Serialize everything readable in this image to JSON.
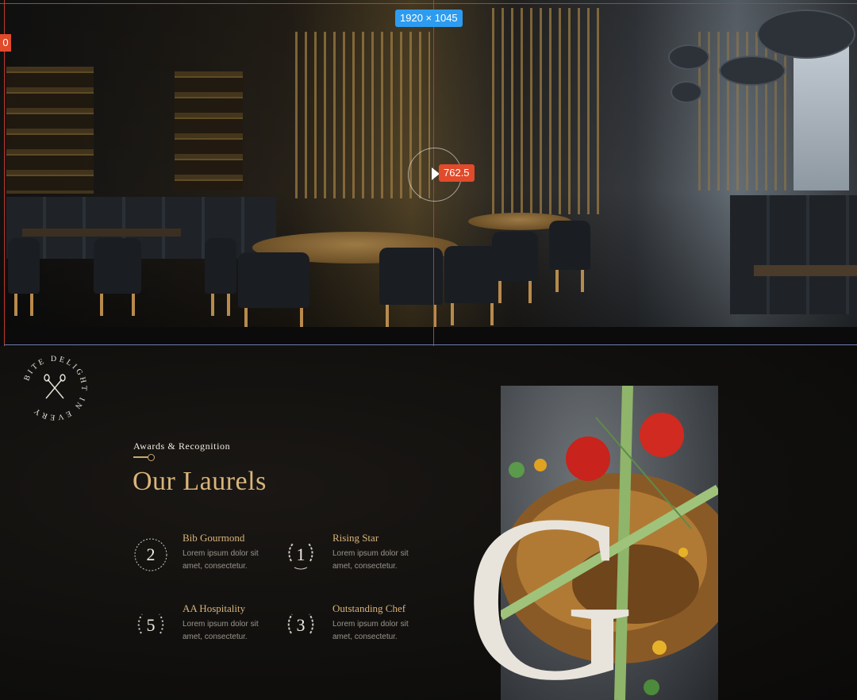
{
  "inspector": {
    "size_badge": "1920 × 1045",
    "position_badge": "762.5",
    "edge_badge": "0"
  },
  "seal": {
    "text": "BITE DELIGHT IN EVERY",
    "icon": "crossed-cutlery-icon"
  },
  "section": {
    "kicker": "Awards & Recognition",
    "title": "Our Laurels"
  },
  "awards": [
    {
      "number": "2",
      "name": "Bib Gourmond",
      "desc": "Lorem ipsum dolor sit amet, consectetur."
    },
    {
      "number": "1",
      "name": "Rising Star",
      "desc": "Lorem ipsum dolor sit amet, consectetur."
    },
    {
      "number": "5",
      "name": "AA Hospitality",
      "desc": "Lorem ipsum dolor sit amet, consectetur."
    },
    {
      "number": "3",
      "name": "Outstanding Chef",
      "desc": "Lorem ipsum dolor sit amet, consectetur."
    }
  ],
  "decor": {
    "big_letter": "G"
  },
  "colors": {
    "gold": "#d9b47a",
    "background": "#0e0d0c",
    "guide_red": "#c0392b",
    "badge_blue": "#2d9cf0"
  }
}
